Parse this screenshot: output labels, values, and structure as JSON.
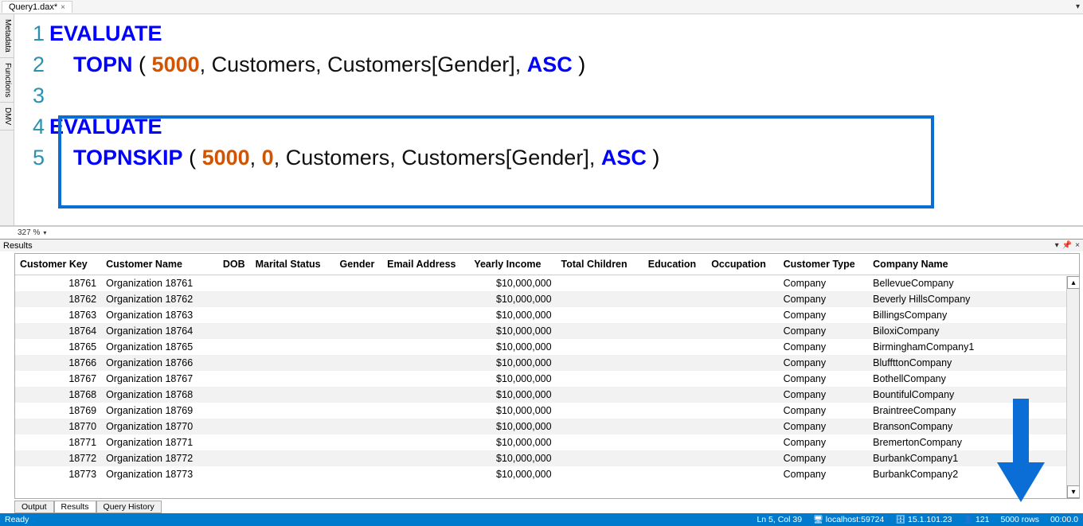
{
  "topTab": {
    "label": "Query1.dax*",
    "close": "×"
  },
  "sideTabs": [
    "Metadata",
    "Functions",
    "DMV"
  ],
  "editor": {
    "lines": [
      {
        "n": "1",
        "tokens": [
          {
            "c": "kw",
            "t": "EVALUATE"
          }
        ]
      },
      {
        "n": "2",
        "tokens": [
          {
            "c": "id",
            "t": "    "
          },
          {
            "c": "fn",
            "t": "TOPN"
          },
          {
            "c": "id",
            "t": " "
          },
          {
            "c": "paren",
            "t": "( "
          },
          {
            "c": "num",
            "t": "5000"
          },
          {
            "c": "id",
            "t": ", Customers, Customers[Gender], "
          },
          {
            "c": "fn",
            "t": "ASC"
          },
          {
            "c": "paren",
            "t": " )"
          }
        ]
      },
      {
        "n": "3",
        "tokens": []
      },
      {
        "n": "4",
        "tokens": [
          {
            "c": "kw",
            "t": "EVALUATE"
          }
        ]
      },
      {
        "n": "5",
        "tokens": [
          {
            "c": "id",
            "t": "    "
          },
          {
            "c": "fn",
            "t": "TOPNSKIP"
          },
          {
            "c": "id",
            "t": " "
          },
          {
            "c": "paren",
            "t": "( "
          },
          {
            "c": "num",
            "t": "5000"
          },
          {
            "c": "id",
            "t": ", "
          },
          {
            "c": "num",
            "t": "0"
          },
          {
            "c": "id",
            "t": ", Customers, Customers[Gender], "
          },
          {
            "c": "fn",
            "t": "ASC"
          },
          {
            "c": "paren",
            "t": " )"
          }
        ]
      }
    ]
  },
  "zoom": "327 %",
  "resultsLabel": "Results",
  "columns": [
    "Customer Key",
    "Customer Name",
    "DOB",
    "Marital Status",
    "Gender",
    "Email Address",
    "Yearly Income",
    "Total Children",
    "Education",
    "Occupation",
    "Customer Type",
    "Company Name"
  ],
  "rows": [
    {
      "key": "18761",
      "name": "Organization 18761",
      "income": "$10,000,000",
      "type": "Company",
      "company": "BellevueCompany"
    },
    {
      "key": "18762",
      "name": "Organization 18762",
      "income": "$10,000,000",
      "type": "Company",
      "company": "Beverly HillsCompany"
    },
    {
      "key": "18763",
      "name": "Organization 18763",
      "income": "$10,000,000",
      "type": "Company",
      "company": "BillingsCompany"
    },
    {
      "key": "18764",
      "name": "Organization 18764",
      "income": "$10,000,000",
      "type": "Company",
      "company": "BiloxiCompany"
    },
    {
      "key": "18765",
      "name": "Organization 18765",
      "income": "$10,000,000",
      "type": "Company",
      "company": "BirminghamCompany1"
    },
    {
      "key": "18766",
      "name": "Organization 18766",
      "income": "$10,000,000",
      "type": "Company",
      "company": "BluffttonCompany"
    },
    {
      "key": "18767",
      "name": "Organization 18767",
      "income": "$10,000,000",
      "type": "Company",
      "company": "BothellCompany"
    },
    {
      "key": "18768",
      "name": "Organization 18768",
      "income": "$10,000,000",
      "type": "Company",
      "company": "BountifulCompany"
    },
    {
      "key": "18769",
      "name": "Organization 18769",
      "income": "$10,000,000",
      "type": "Company",
      "company": "BraintreeCompany"
    },
    {
      "key": "18770",
      "name": "Organization 18770",
      "income": "$10,000,000",
      "type": "Company",
      "company": "BransonCompany"
    },
    {
      "key": "18771",
      "name": "Organization 18771",
      "income": "$10,000,000",
      "type": "Company",
      "company": "BremertonCompany"
    },
    {
      "key": "18772",
      "name": "Organization 18772",
      "income": "$10,000,000",
      "type": "Company",
      "company": "BurbankCompany1"
    },
    {
      "key": "18773",
      "name": "Organization 18773",
      "income": "$10,000,000",
      "type": "Company",
      "company": "BurbankCompany2"
    }
  ],
  "bottomTabs": {
    "output": "Output",
    "results": "Results",
    "history": "Query History"
  },
  "status": {
    "ready": "Ready",
    "lncol": "Ln 5, Col 39",
    "host": "localhost:59724",
    "ver": "15.1.101.23",
    "spid": "121",
    "rows": "5000 rows",
    "time": "00:00.0"
  }
}
